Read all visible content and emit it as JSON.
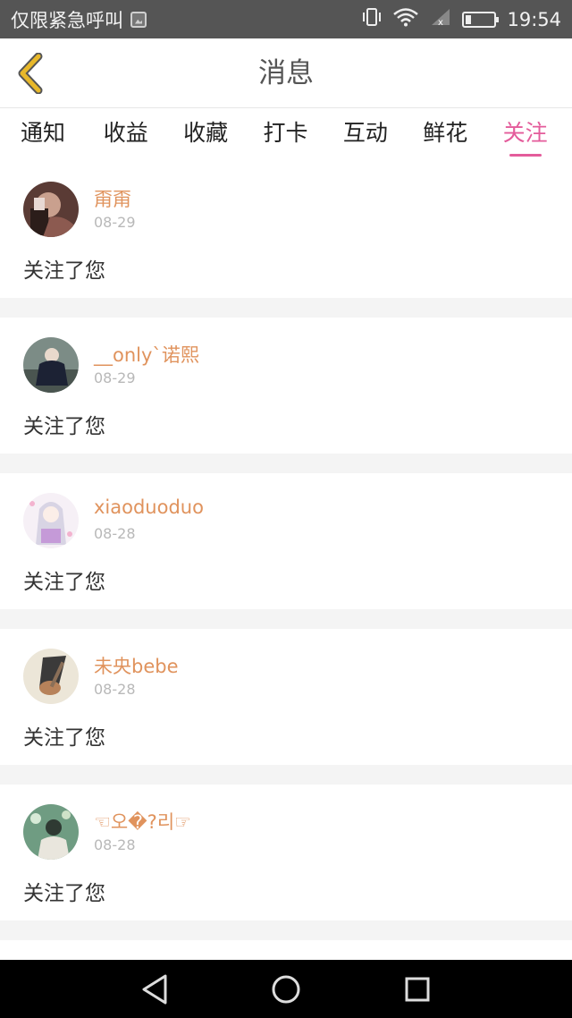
{
  "status_bar": {
    "carrier": "仅限紧急呼叫",
    "time": "19:54"
  },
  "header": {
    "title": "消息",
    "back_icon": "chevron-left-icon",
    "back_color": "#e8b82a"
  },
  "tabs": [
    {
      "label": "通知",
      "active": false
    },
    {
      "label": "收益",
      "active": false
    },
    {
      "label": "收藏",
      "active": false
    },
    {
      "label": "打卡",
      "active": false
    },
    {
      "label": "互动",
      "active": false
    },
    {
      "label": "鲜花",
      "active": false
    },
    {
      "label": "关注",
      "active": true
    }
  ],
  "notifications": [
    {
      "username": "甭甭",
      "date": "08-29",
      "message": "关注了您"
    },
    {
      "username": "__only`诺熙",
      "date": "08-29",
      "message": "关注了您"
    },
    {
      "username": "xiaoduoduo",
      "date": "08-28",
      "message": "关注了您"
    },
    {
      "username": "未央bebe",
      "date": "08-28",
      "message": "关注了您"
    },
    {
      "username": "☜오�?리☞",
      "date": "08-28",
      "message": "关注了您"
    }
  ],
  "colors": {
    "accent": "#e45c9b",
    "username": "#e0935d",
    "date": "#b8b8b8"
  },
  "nav": {
    "back_icon": "triangle-back-icon",
    "home_icon": "circle-home-icon",
    "recents_icon": "square-recents-icon"
  }
}
